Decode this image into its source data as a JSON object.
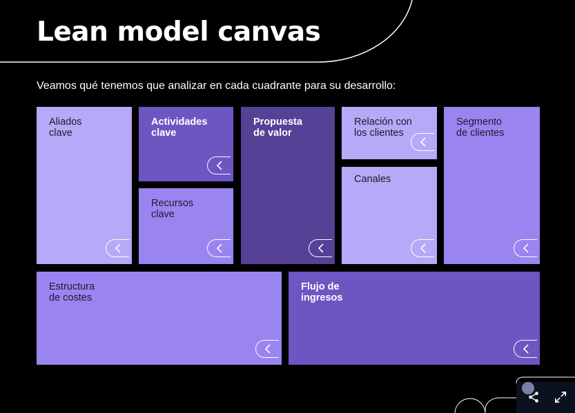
{
  "header": {
    "title": "Lean model canvas",
    "subtitle": "Veamos qué tenemos que analizar en cada cuadrante para su desarrollo:"
  },
  "canvas": {
    "aliados": "Aliados\nclave",
    "actividades": "Actividades\nclave",
    "recursos": "Recursos\nclave",
    "propuesta": "Propuesta\nde valor",
    "relacion": "Relación con\nlos clientes",
    "canales": "Canales",
    "segmento": "Segmento\nde clientes",
    "estructura": "Estructura\nde costes",
    "flujo": "Flujo de\ningresos"
  },
  "colors": {
    "light_lavender": "#b7a9f7",
    "medium_purple": "#9a85f0",
    "purple": "#6d56c2",
    "dark_purple": "#554196",
    "background": "#000000"
  },
  "icons": {
    "tile_expand": "chevron-left-icon",
    "share": "share-icon",
    "fullscreen": "expand-icon"
  }
}
